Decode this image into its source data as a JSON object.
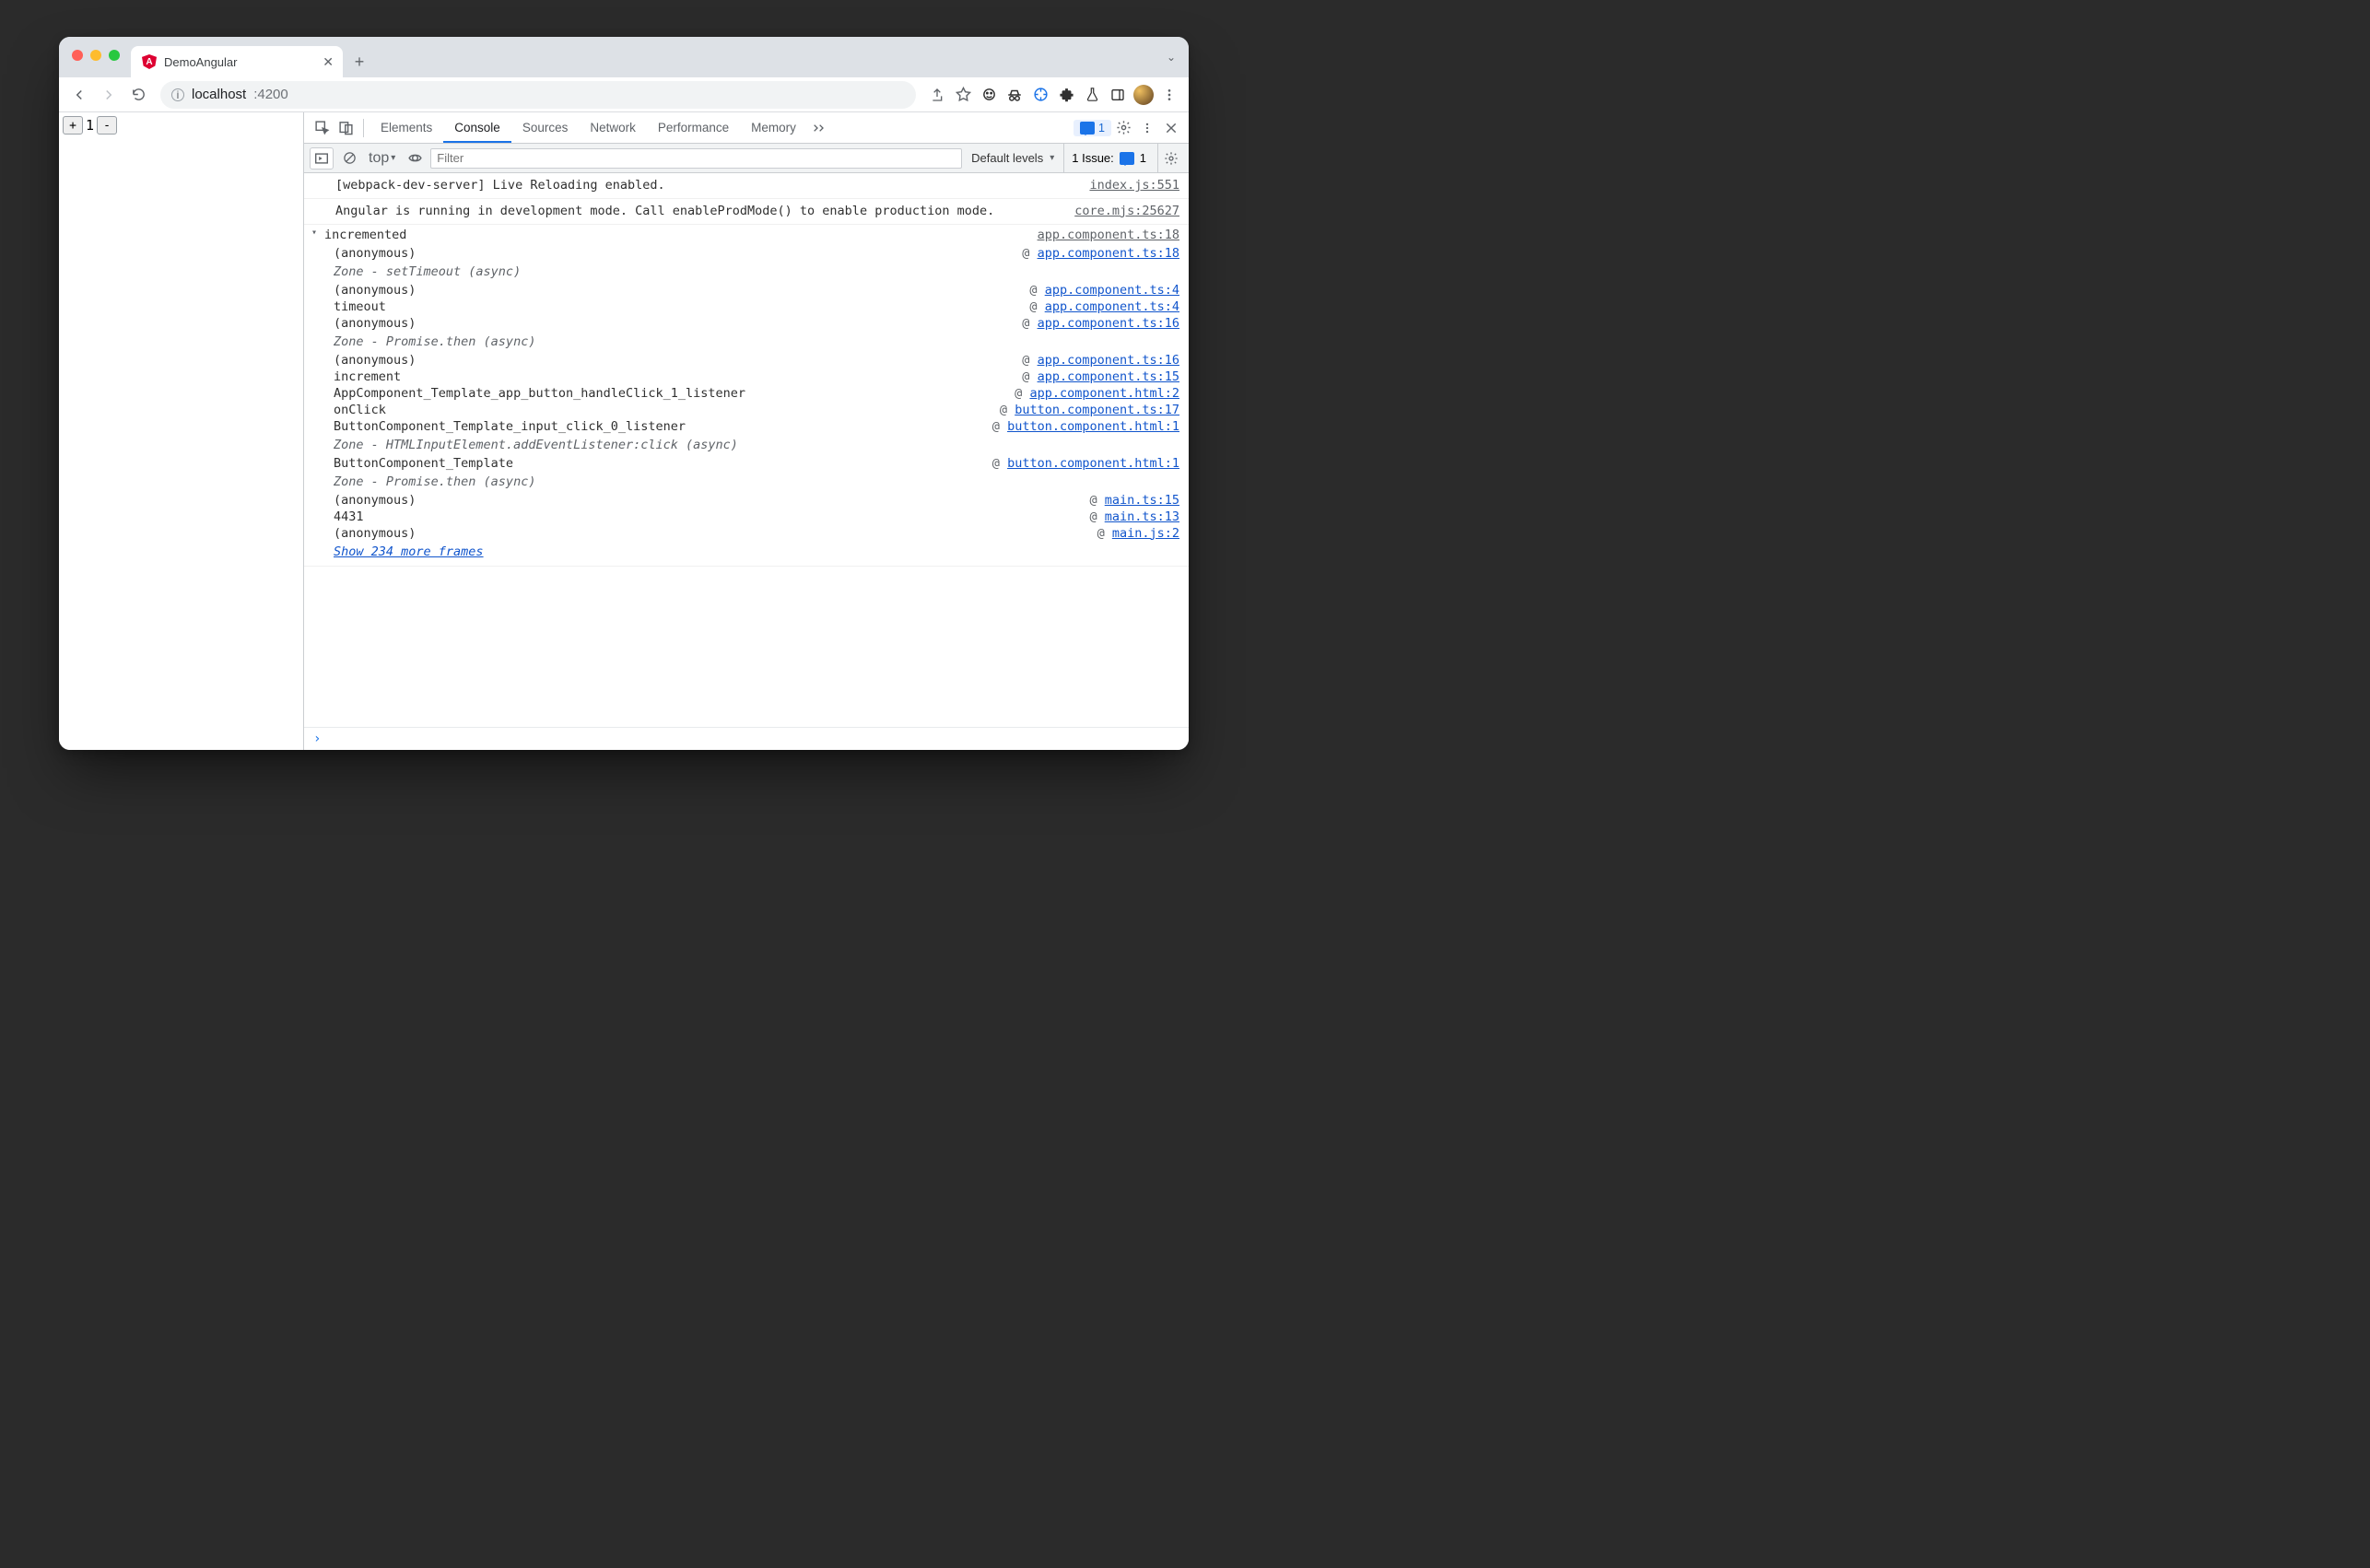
{
  "browser": {
    "tab_title": "DemoAngular",
    "url_host": "localhost",
    "url_port": ":4200"
  },
  "page": {
    "counter_value": "1",
    "plus_label": "+",
    "minus_label": "-"
  },
  "devtools": {
    "tabs": {
      "elements": "Elements",
      "console": "Console",
      "sources": "Sources",
      "network": "Network",
      "performance": "Performance",
      "memory": "Memory"
    },
    "comment_count": "1",
    "filter": {
      "context": "top",
      "filter_placeholder": "Filter",
      "levels_label": "Default levels",
      "issues_label": "1 Issue:",
      "issues_count": "1"
    },
    "messages": [
      {
        "text": "[webpack-dev-server] Live Reloading enabled.",
        "src": "index.js:551"
      },
      {
        "text": "Angular is running in development mode. Call enableProdMode() to enable production mode.",
        "src": "core.mjs:25627"
      }
    ],
    "trace": {
      "label": "incremented",
      "src": "app.component.ts:18",
      "frames": [
        {
          "type": "frame",
          "fn": "(anonymous)",
          "link": "app.component.ts:18"
        },
        {
          "type": "group",
          "text": "Zone - setTimeout (async)"
        },
        {
          "type": "frame",
          "fn": "(anonymous)",
          "link": "app.component.ts:4"
        },
        {
          "type": "frame",
          "fn": "timeout",
          "link": "app.component.ts:4"
        },
        {
          "type": "frame",
          "fn": "(anonymous)",
          "link": "app.component.ts:16"
        },
        {
          "type": "group",
          "text": "Zone - Promise.then (async)"
        },
        {
          "type": "frame",
          "fn": "(anonymous)",
          "link": "app.component.ts:16"
        },
        {
          "type": "frame",
          "fn": "increment",
          "link": "app.component.ts:15"
        },
        {
          "type": "frame",
          "fn": "AppComponent_Template_app_button_handleClick_1_listener",
          "link": "app.component.html:2"
        },
        {
          "type": "frame",
          "fn": "onClick",
          "link": "button.component.ts:17"
        },
        {
          "type": "frame",
          "fn": "ButtonComponent_Template_input_click_0_listener",
          "link": "button.component.html:1"
        },
        {
          "type": "group",
          "text": "Zone - HTMLInputElement.addEventListener:click (async)"
        },
        {
          "type": "frame",
          "fn": "ButtonComponent_Template",
          "link": "button.component.html:1"
        },
        {
          "type": "group",
          "text": "Zone - Promise.then (async)"
        },
        {
          "type": "frame",
          "fn": "(anonymous)",
          "link": "main.ts:15"
        },
        {
          "type": "frame",
          "fn": "4431",
          "link": "main.ts:13"
        },
        {
          "type": "frame",
          "fn": "(anonymous)",
          "link": "main.js:2"
        }
      ],
      "show_more": "Show 234 more frames"
    }
  }
}
